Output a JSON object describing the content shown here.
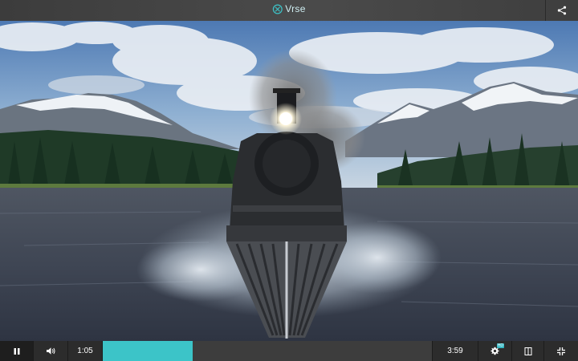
{
  "app": {
    "brand_name": "Vrse",
    "accent_color": "#3cc4c8"
  },
  "header": {
    "share_icon": "share-icon"
  },
  "video": {
    "scene_description_icon": "video-frame"
  },
  "controls": {
    "play_icon": "pause-icon",
    "volume_icon": "volume-icon",
    "current_time": "1:05",
    "total_time": "3:59",
    "progress_fraction": 0.272,
    "settings_icon": "gear-icon",
    "settings_badge": "HD",
    "vr_icon": "vr-mode-icon",
    "fullscreen_icon": "exit-fullscreen-icon"
  }
}
